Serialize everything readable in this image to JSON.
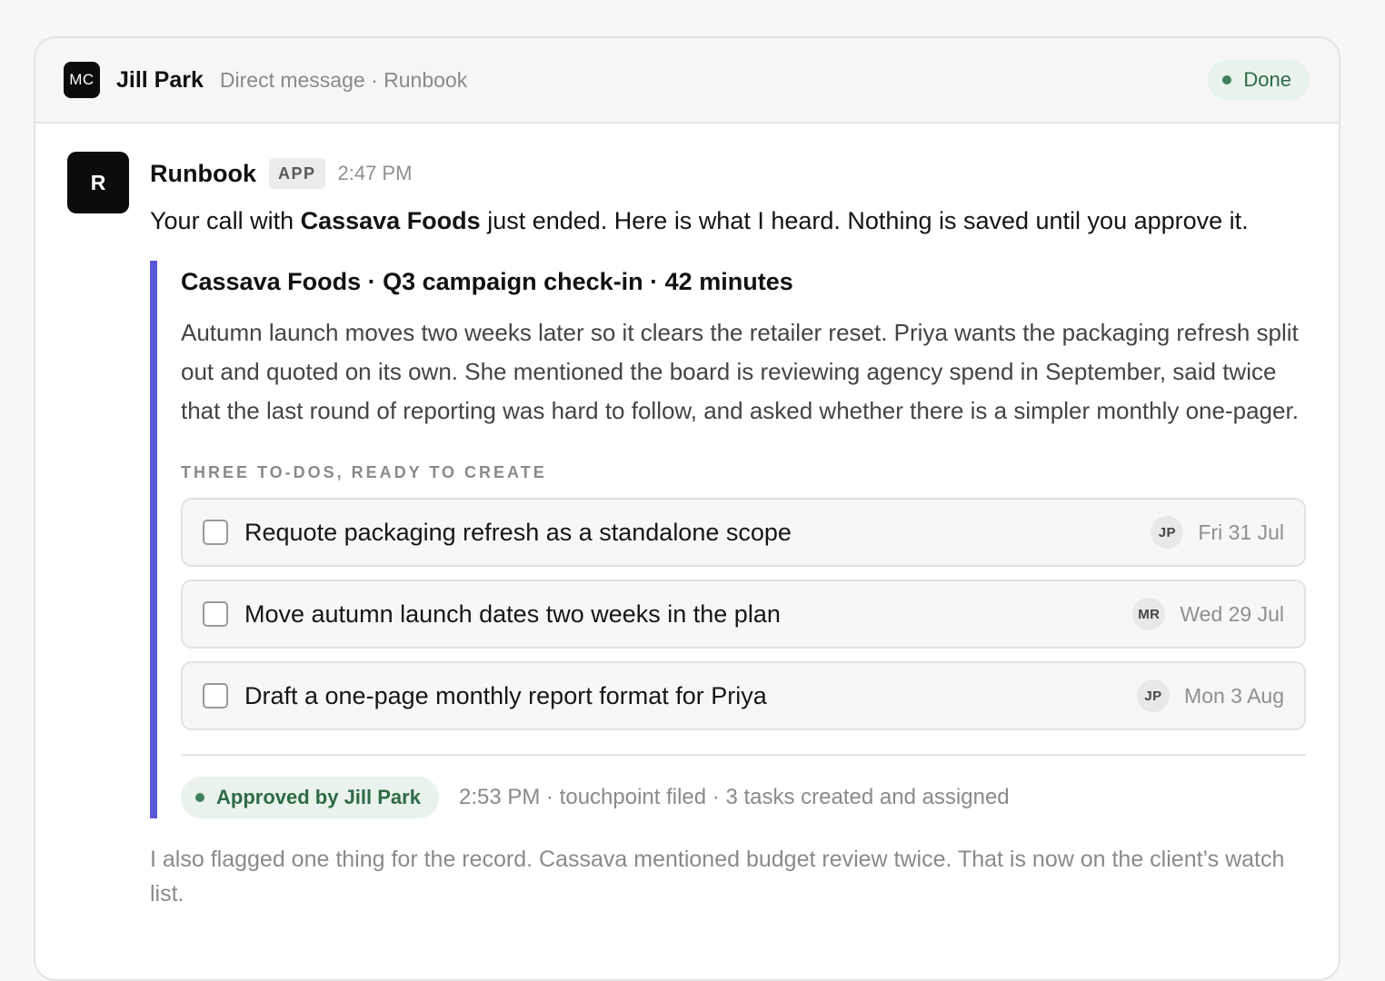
{
  "header": {
    "avatar_initials": "MC",
    "name": "Jill Park",
    "subtitle": "Direct message · Runbook",
    "status": "Done"
  },
  "message": {
    "avatar_letter": "R",
    "sender": "Runbook",
    "badge": "APP",
    "time": "2:47 PM",
    "intro_prefix": "Your call with ",
    "intro_bold": "Cassava Foods",
    "intro_suffix": " just ended. Here is what I heard. Nothing is saved until you approve it."
  },
  "card": {
    "title": "Cassava Foods · Q3 campaign check-in · 42 minutes",
    "summary": "Autumn launch moves two weeks later so it clears the retailer reset. Priya wants the packaging refresh split out and quoted on its own. She mentioned the board is reviewing agency spend in September, said twice that the last round of reporting was hard to follow, and asked whether there is a simpler monthly one-pager.",
    "todos_label": "THREE TO-DOS, READY TO CREATE",
    "todos": [
      {
        "text": "Requote packaging refresh as a standalone scope",
        "assignee": "JP",
        "due": "Fri 31 Jul",
        "checked": false
      },
      {
        "text": "Move autumn launch dates two weeks in the plan",
        "assignee": "MR",
        "due": "Wed 29 Jul",
        "checked": false
      },
      {
        "text": "Draft a one-page monthly report format for Priya",
        "assignee": "JP",
        "due": "Mon 3 Aug",
        "checked": false
      }
    ],
    "approval": {
      "label": "Approved by Jill Park",
      "meta": "2:53 PM · touchpoint filed · 3 tasks created and assigned"
    }
  },
  "footnote": "I also flagged one thing for the record. Cassava mentioned budget review twice. That is now on the client’s watch list.",
  "colors": {
    "accent_bar": "#5b58d8",
    "status_green": "#3f8159",
    "status_bg": "#e9f3ec"
  }
}
